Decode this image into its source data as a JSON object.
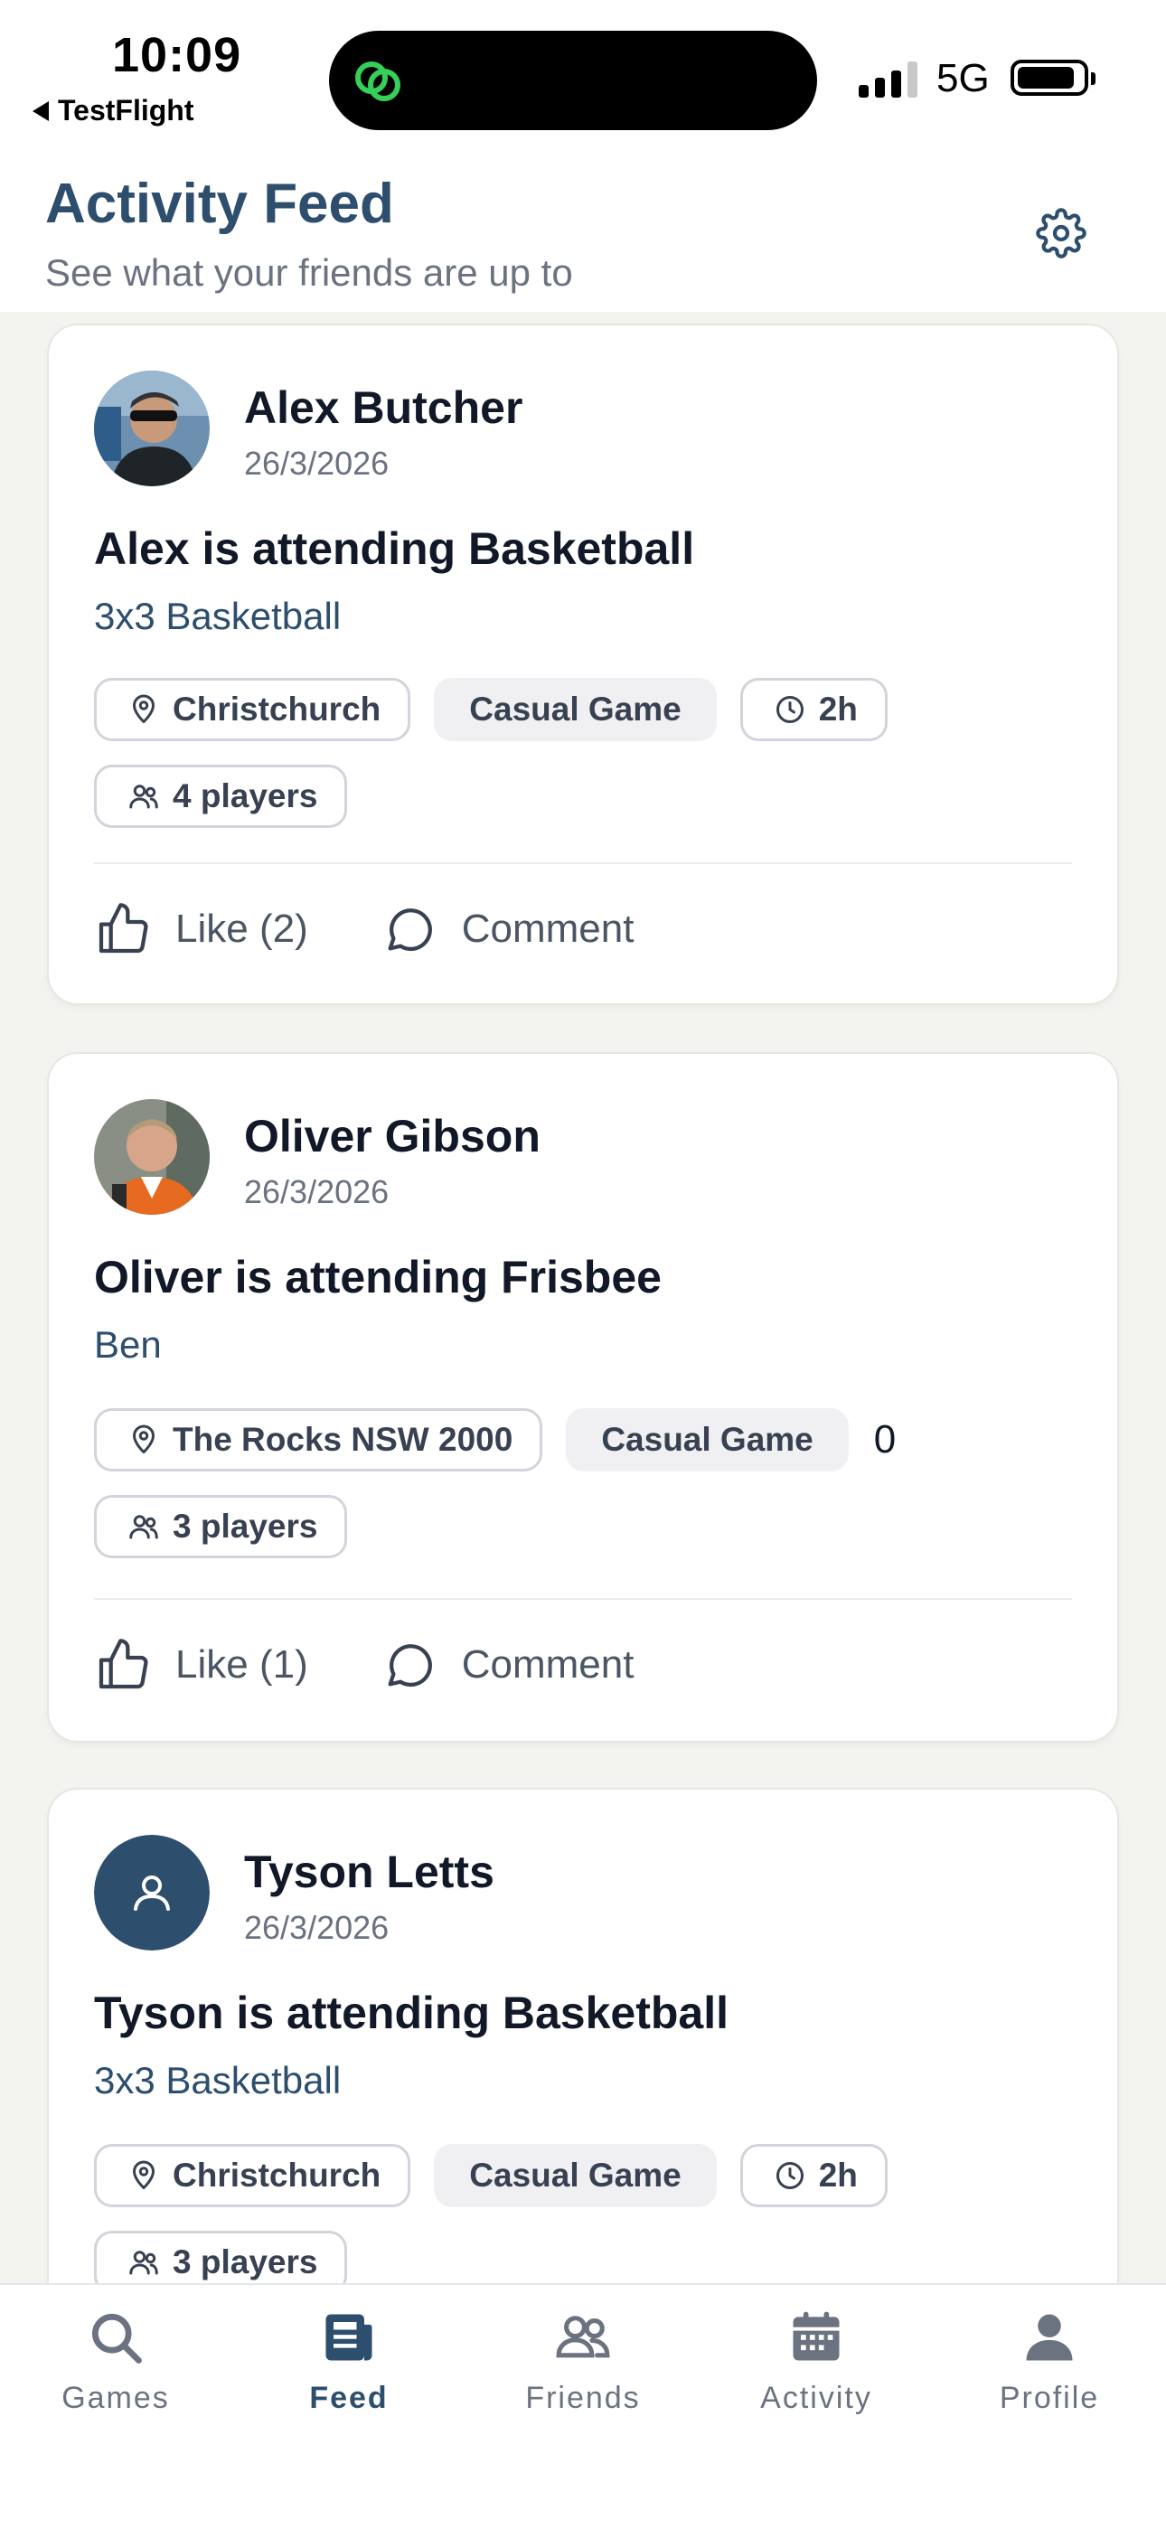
{
  "status_bar": {
    "time": "10:09",
    "back_app": "TestFlight",
    "network": "5G"
  },
  "header": {
    "title": "Activity Feed",
    "subtitle": "See what your friends are up to"
  },
  "feed": [
    {
      "name": "Alex Butcher",
      "date": "26/3/2026",
      "title": "Alex is attending Basketball",
      "subtitle": "3x3 Basketball",
      "location": "Christchurch",
      "game_type": "Casual Game",
      "duration": "2h",
      "players": "4 players",
      "like": "Like (2)",
      "comment": "Comment"
    },
    {
      "name": "Oliver Gibson",
      "date": "26/3/2026",
      "title": "Oliver is attending Frisbee",
      "subtitle": "Ben",
      "location": "The Rocks NSW 2000",
      "game_type": "Casual Game",
      "extra_value": "0",
      "players": "3 players",
      "like": "Like (1)",
      "comment": "Comment"
    },
    {
      "name": "Tyson Letts",
      "date": "26/3/2026",
      "title": "Tyson is attending Basketball",
      "subtitle": "3x3 Basketball",
      "location": "Christchurch",
      "game_type": "Casual Game",
      "duration": "2h",
      "players": "3 players"
    }
  ],
  "tabs": [
    {
      "label": "Games",
      "icon": "search-icon"
    },
    {
      "label": "Feed",
      "icon": "newspaper-icon",
      "active": true
    },
    {
      "label": "Friends",
      "icon": "friends-icon"
    },
    {
      "label": "Activity",
      "icon": "calendar-icon"
    },
    {
      "label": "Profile",
      "icon": "person-icon"
    }
  ],
  "colors": {
    "accent": "#2d4e6d",
    "muted": "#6b7280",
    "background": "#f3f3ef",
    "island_icon": "#34d058"
  }
}
